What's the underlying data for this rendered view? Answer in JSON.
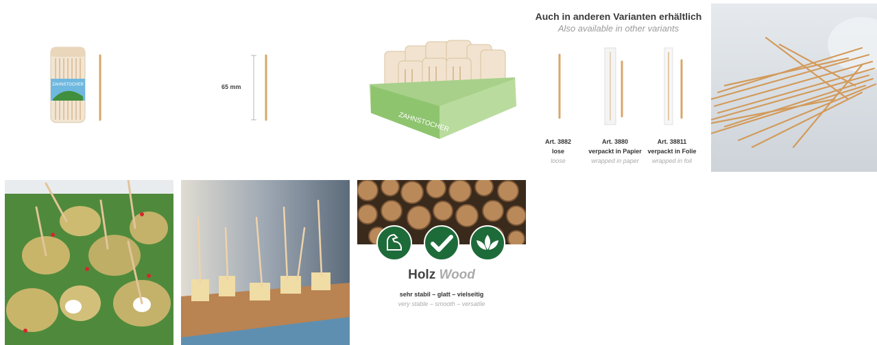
{
  "product_tile": {
    "label": "ZAHNSTOCHER"
  },
  "size_tile": {
    "length_label": "65 mm"
  },
  "box_tile": {
    "label": "ZAHNSTOCHER"
  },
  "variants": {
    "title": "Auch in anderen Varianten erhältlich",
    "subtitle": "Also available in other variants",
    "items": [
      {
        "art": "Art. 3882",
        "de": "lose",
        "en": "loose"
      },
      {
        "art": "Art. 3880",
        "de": "verpackt in Papier",
        "en": "wrapped in paper"
      },
      {
        "art": "Art. 38811",
        "de": "verpackt in Folie",
        "en": "wrapped in foil"
      }
    ]
  },
  "material": {
    "title_de": "Holz",
    "title_en": "Wood",
    "desc_de": "sehr stabil – glatt – vielseitig",
    "desc_en": "very stable – smooth – versatile",
    "icons": [
      "strength-icon",
      "check-icon",
      "leaf-icon"
    ],
    "icon_color": "#1e6b3a"
  },
  "colors": {
    "wood": "#d9a66b",
    "green": "#1e6b3a",
    "blue_label": "#5aa8d8"
  }
}
